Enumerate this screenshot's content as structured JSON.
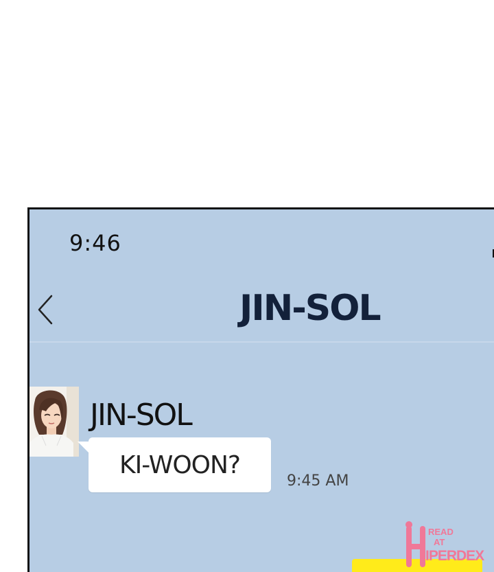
{
  "status_bar": {
    "time": "9:46"
  },
  "header": {
    "title": "JIN-SOL",
    "back_icon": "chevron-left-icon"
  },
  "messages": [
    {
      "direction": "incoming",
      "sender": "JIN-SOL",
      "text": "KI-WOON?",
      "time": "9:45 AM"
    },
    {
      "direction": "outgoing",
      "text": ""
    }
  ],
  "watermark": {
    "line1": "READ",
    "line2": "AT",
    "brand": "IPERDEX"
  },
  "colors": {
    "chat_background": "#b7cde4",
    "incoming_bubble": "#ffffff",
    "outgoing_bubble": "#ffeb1a",
    "title_color": "#13213a",
    "watermark": "#f07898"
  }
}
